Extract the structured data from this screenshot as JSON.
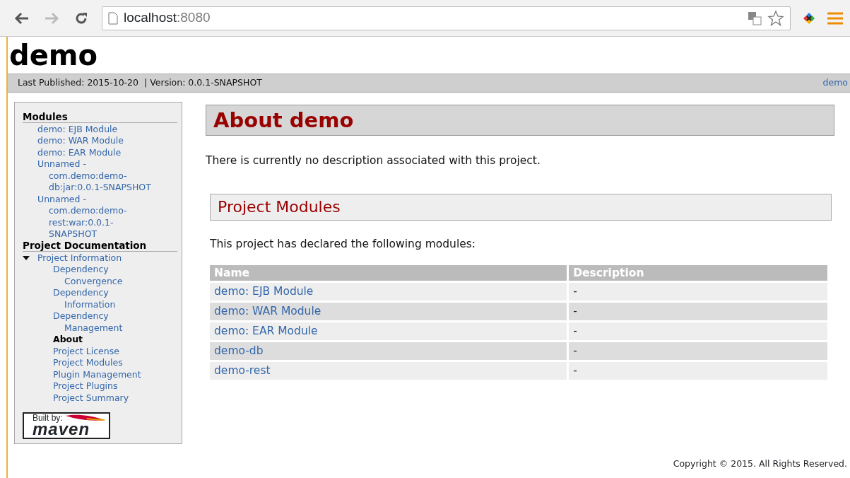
{
  "browser": {
    "address_host": "localhost",
    "address_port": ":8080"
  },
  "site_title": "demo",
  "banner": {
    "published": "Last Published: 2015-10-20",
    "version": "| Version: 0.0.1-SNAPSHOT",
    "link": "demo"
  },
  "sidebar": {
    "sections": [
      {
        "title": "Modules",
        "items": [
          {
            "label": "demo: EJB Module",
            "selected": false
          },
          {
            "label": "demo: WAR Module",
            "selected": false
          },
          {
            "label": "demo: EAR Module",
            "selected": false
          },
          {
            "label": "Unnamed - com.demo:demo-db:jar:0.0.1-SNAPSHOT",
            "selected": false
          },
          {
            "label": "Unnamed - com.demo:demo-rest:war:0.0.1-SNAPSHOT",
            "selected": false
          }
        ]
      },
      {
        "title": "Project Documentation",
        "items": [
          {
            "label": "Project Information",
            "selected": false,
            "expanded": true,
            "children": [
              {
                "label": "Dependency Convergence",
                "selected": false
              },
              {
                "label": "Dependency Information",
                "selected": false
              },
              {
                "label": "Dependency Management",
                "selected": false
              },
              {
                "label": "About",
                "selected": true
              },
              {
                "label": "Project License",
                "selected": false
              },
              {
                "label": "Project Modules",
                "selected": false
              },
              {
                "label": "Plugin Management",
                "selected": false
              },
              {
                "label": "Project Plugins",
                "selected": false
              },
              {
                "label": "Project Summary",
                "selected": false
              }
            ]
          }
        ]
      }
    ],
    "badge": {
      "caption": "Built by:",
      "logo_text": "maven"
    }
  },
  "main": {
    "title": "About demo",
    "intro": "There is currently no description associated with this project.",
    "section_title": "Project Modules",
    "section_intro": "This project has declared the following modules:",
    "table": {
      "columns": [
        "Name",
        "Description"
      ],
      "rows": [
        [
          "demo: EJB Module",
          "-"
        ],
        [
          "demo: WAR Module",
          "-"
        ],
        [
          "demo: EAR Module",
          "-"
        ],
        [
          "demo-db",
          "-"
        ],
        [
          "demo-rest",
          "-"
        ]
      ]
    }
  },
  "footer": "Copyright © 2015. All Rights Reserved."
}
